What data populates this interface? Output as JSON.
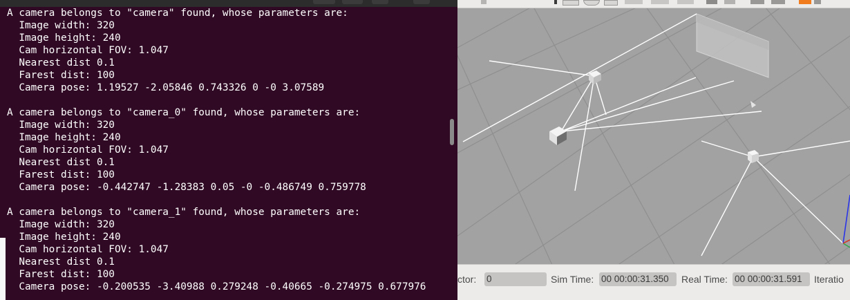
{
  "terminal": {
    "lines": [
      "A camera belongs to \"camera\" found, whose parameters are:",
      "  Image width: 320",
      "  Image height: 240",
      "  Cam horizontal FOV: 1.047",
      "  Nearest dist 0.1",
      "  Farest dist: 100",
      "  Camera pose: 1.19527 -2.05846 0.743326 0 -0 3.07589",
      "",
      "A camera belongs to \"camera_0\" found, whose parameters are:",
      "  Image width: 320",
      "  Image height: 240",
      "  Cam horizontal FOV: 1.047",
      "  Nearest dist 0.1",
      "  Farest dist: 100",
      "  Camera pose: -0.442747 -1.28383 0.05 -0 -0.486749 0.759778",
      "",
      "A camera belongs to \"camera_1\" found, whose parameters are:",
      "  Image width: 320",
      "  Image height: 240",
      "  Cam horizontal FOV: 1.047",
      "  Nearest dist 0.1",
      "  Farest dist: 100",
      "  Camera pose: -0.200535 -3.40988 0.279248 -0.40665 -0.274975 0.677976"
    ]
  },
  "gazebo": {
    "status": {
      "factor_label": "ctor:",
      "factor_value": "0",
      "sim_time_label": "Sim Time:",
      "sim_time_value": "00 00:00:31.350",
      "real_time_label": "Real Time:",
      "real_time_value": "00 00:00:31.591",
      "iterations_label": "Iteratio"
    },
    "colors": {
      "scene_background": "#a2a2a2",
      "grid": "#8e8e8e",
      "terminal_background": "#300a24"
    }
  }
}
